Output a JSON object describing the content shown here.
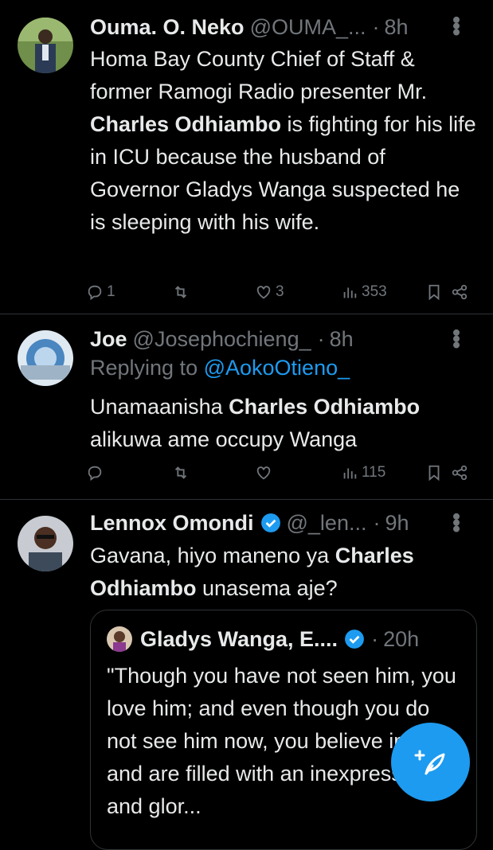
{
  "tweets": [
    {
      "name": "Ouma. O. Neko",
      "handle": "@OUMA_...",
      "time": "8h",
      "body_parts": [
        "Homa Bay County Chief of Staff & former Ramogi Radio presenter Mr. ",
        "Charles Odhiambo",
        " is fighting for his life in ICU because the husband of Governor Gladys Wanga suspected he is sleeping with his wife."
      ],
      "replies": "1",
      "retweets": "",
      "likes": "3",
      "views": "353"
    },
    {
      "name": "Joe",
      "handle": "@Josephochieng_",
      "time": "8h",
      "replying_label": "Replying to",
      "replying_handle": "@AokoOtieno_",
      "body_parts": [
        "Unamaanisha ",
        "Charles Odhiambo",
        " alikuwa ame occupy Wanga"
      ],
      "replies": "",
      "retweets": "",
      "likes": "",
      "views": "115"
    },
    {
      "name": "Lennox Omondi",
      "handle": "@_len...",
      "time": "9h",
      "body_parts": [
        "Gavana, hiyo maneno ya ",
        "Charles Odhiambo",
        " unasema aje?"
      ],
      "quote": {
        "name": "Gladys Wanga, E....",
        "time": "20h",
        "body": "\"Though you have not seen him, you love him; and even though you do not see him now, you believe in him and are filled with an inexpressible and glor..."
      }
    }
  ],
  "separator": "·",
  "colors": {
    "background": "#000000",
    "text": "#e7e9ea",
    "muted": "#71767b",
    "accent": "#1d9bf0",
    "divider": "#2f3336"
  },
  "icons": [
    "more-icon",
    "reply-icon",
    "retweet-icon",
    "like-icon",
    "views-icon",
    "bookmark-icon",
    "share-icon",
    "verified-icon",
    "compose-icon"
  ]
}
